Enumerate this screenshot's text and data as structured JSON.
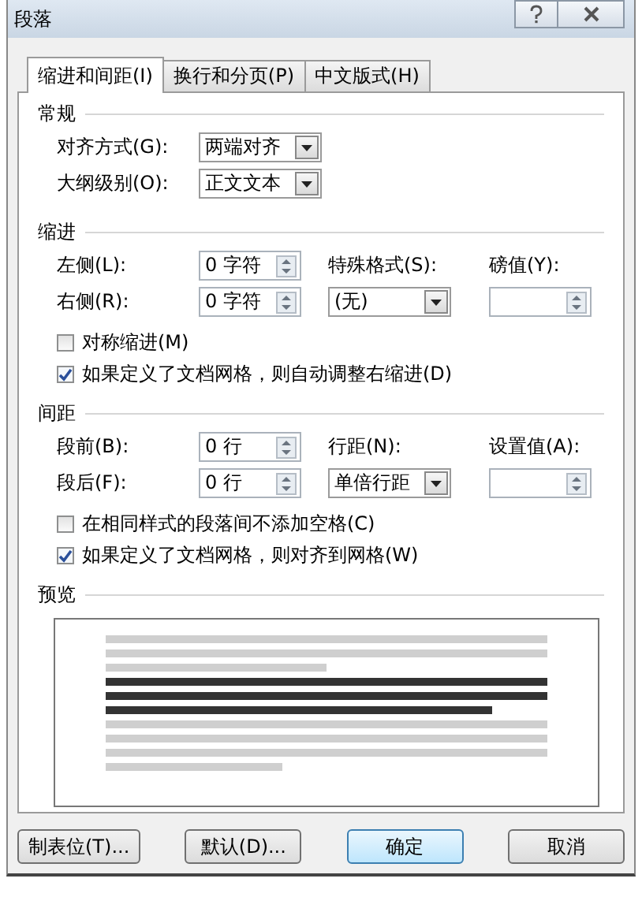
{
  "window": {
    "title": "段落"
  },
  "tabs": [
    {
      "label": "缩进和间距(I)",
      "selected": true
    },
    {
      "label": "换行和分页(P)",
      "selected": false
    },
    {
      "label": "中文版式(H)",
      "selected": false
    }
  ],
  "sections": [
    {
      "heading": "常规",
      "rows": [
        [
          {
            "kind": "label",
            "text": "对齐方式(G):"
          },
          {
            "kind": "dropdown",
            "value": "两端对齐"
          }
        ],
        [
          {
            "kind": "label",
            "text": "大纲级别(O):"
          },
          {
            "kind": "dropdown",
            "value": "正文文本"
          }
        ]
      ]
    },
    {
      "heading": "缩进",
      "rows": [
        [
          {
            "kind": "label",
            "text": "左侧(L):"
          },
          {
            "kind": "spinner",
            "value": "0 字符"
          },
          {
            "kind": "label",
            "text": "特殊格式(S):"
          },
          {
            "kind": "label",
            "text": "磅值(Y):"
          }
        ],
        [
          {
            "kind": "label",
            "text": "右侧(R):"
          },
          {
            "kind": "spinner",
            "value": "0 字符"
          },
          {
            "kind": "dropdown",
            "value": "(无)"
          },
          {
            "kind": "spinner"
          }
        ]
      ],
      "checkboxes": [
        {
          "label": "对称缩进(M)",
          "checked": false
        },
        {
          "label": "如果定义了文档网格，则自动调整右缩进(D)",
          "checked": true
        }
      ]
    },
    {
      "heading": "间距",
      "rows": [
        [
          {
            "kind": "label",
            "text": "段前(B):"
          },
          {
            "kind": "spinner",
            "value": "0 行"
          },
          {
            "kind": "label",
            "text": "行距(N):"
          },
          {
            "kind": "label",
            "text": "设置值(A):"
          }
        ],
        [
          {
            "kind": "label",
            "text": "段后(F):"
          },
          {
            "kind": "spinner",
            "value": "0 行"
          },
          {
            "kind": "dropdown",
            "value": "单倍行距"
          },
          {
            "kind": "spinner"
          }
        ]
      ],
      "checkboxes": [
        {
          "label": "在相同样式的段落间不添加空格(C)",
          "checked": false
        },
        {
          "label": "如果定义了文档网格，则对齐到网格(W)",
          "checked": true
        }
      ]
    },
    {
      "heading": "预览",
      "kind": "preview"
    }
  ],
  "buttons": [
    {
      "label": "制表位(T)...",
      "default": false
    },
    {
      "label": "默认(D)...",
      "default": false
    },
    {
      "label": "确定",
      "default": true
    },
    {
      "label": "取消",
      "default": false
    }
  ]
}
